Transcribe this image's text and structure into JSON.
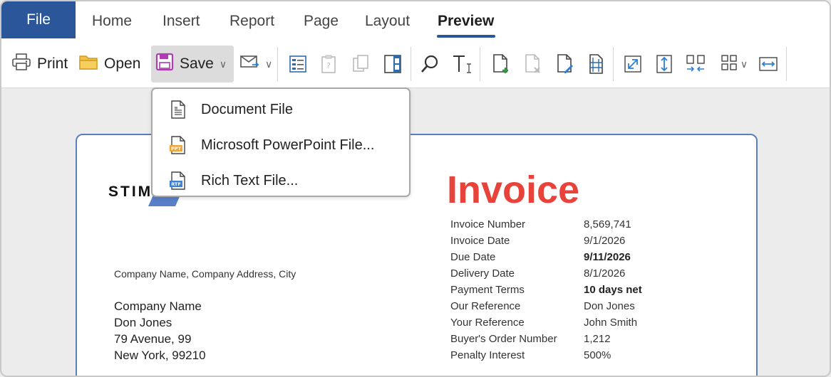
{
  "tabs": {
    "file": "File",
    "home": "Home",
    "insert": "Insert",
    "report": "Report",
    "page": "Page",
    "layout": "Layout",
    "preview": "Preview"
  },
  "toolbar": {
    "print": "Print",
    "open": "Open",
    "save": "Save"
  },
  "save_menu": {
    "items": [
      {
        "label": "Document File",
        "icon": "document-file-icon"
      },
      {
        "label": "Microsoft PowerPoint File...",
        "icon": "ppt-file-icon",
        "badge": "PPT"
      },
      {
        "label": "Rich Text File...",
        "icon": "rtf-file-icon",
        "badge": "RTF"
      }
    ]
  },
  "document": {
    "logo": "STIM",
    "title": "Invoice",
    "company_line": "Company Name, Company Address, City",
    "address": [
      "Company Name",
      "Don Jones",
      "79 Avenue, 99",
      "New York, 99210"
    ],
    "details": [
      {
        "label": "Invoice Number",
        "value": "8,569,741",
        "bold": false
      },
      {
        "label": "Invoice Date",
        "value": "9/1/2026",
        "bold": false
      },
      {
        "label": "Due Date",
        "value": "9/11/2026",
        "bold": true
      },
      {
        "label": "Delivery Date",
        "value": "8/1/2026",
        "bold": false
      },
      {
        "label": "Payment Terms",
        "value": "10 days net",
        "bold": true
      },
      {
        "label": "Our Reference",
        "value": "Don Jones",
        "bold": false
      },
      {
        "label": "Your Reference",
        "value": "John Smith",
        "bold": false
      },
      {
        "label": "Buyer's Order Number",
        "value": "1,212",
        "bold": false
      },
      {
        "label": "Penalty Interest",
        "value": "500%",
        "bold": false
      }
    ]
  },
  "colors": {
    "file_tab": "#2b579a",
    "accent_underline": "#2b579a",
    "invoice_title": "#e8433a",
    "paper_border": "#5b7fbd",
    "save_icon": "#b13bb3"
  }
}
